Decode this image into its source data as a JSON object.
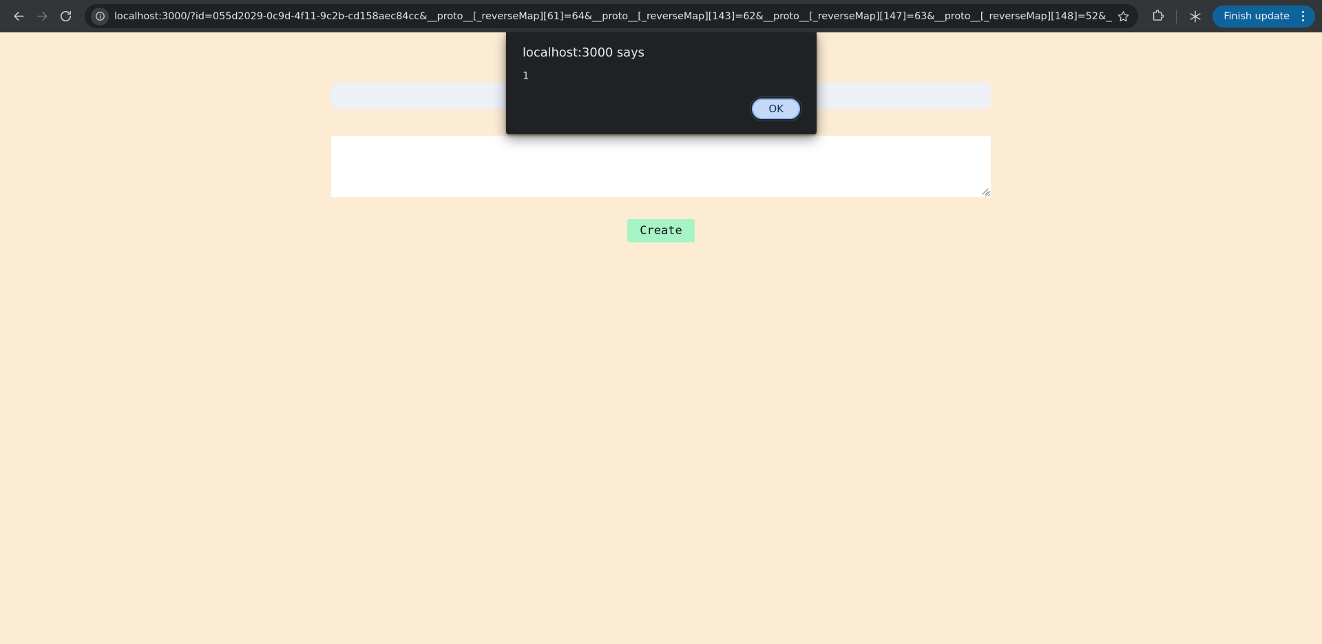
{
  "browser": {
    "back_tooltip": "Back",
    "forward_tooltip": "Forward",
    "reload_tooltip": "Reload this page",
    "site_info_tooltip": "View site information",
    "url": "localhost:3000/?id=055d2029-0c9d-4f11-9c2b-cd158aec84cc&__proto__[_reverseMap][61]=64&__proto__[_reverseMap][143]=62&__proto__[_reverseMap][147]=63&__proto__[_reverseMap][148]=52&__proto__[_reverseMap][149]=53&…",
    "bookmark_tooltip": "Bookmark this tab",
    "extensions_tooltip": "Extensions",
    "ai_tooltip": "Gemini",
    "finish_update_label": "Finish update",
    "menu_tooltip": "Customize and control Google Chrome",
    "colors": {
      "chrome_bg": "#323639",
      "omnibox_bg": "#1f2123",
      "update_button": "#0f639b",
      "url_text": "#dfe1e5"
    }
  },
  "page": {
    "background_color": "#FDECD4",
    "form": {
      "title_input_value": "",
      "title_input_placeholder": "",
      "body_textarea_value": "",
      "body_textarea_placeholder": "",
      "create_button_label": "Create",
      "create_button_color": "#A6F3C6",
      "title_input_color": "#EDF1F7",
      "body_textarea_color": "#FFFFFF"
    }
  },
  "dialog": {
    "title": "localhost:3000 says",
    "message": "1",
    "ok_label": "OK",
    "background_color": "#202124",
    "ok_button_color": "#c3d9f5"
  }
}
